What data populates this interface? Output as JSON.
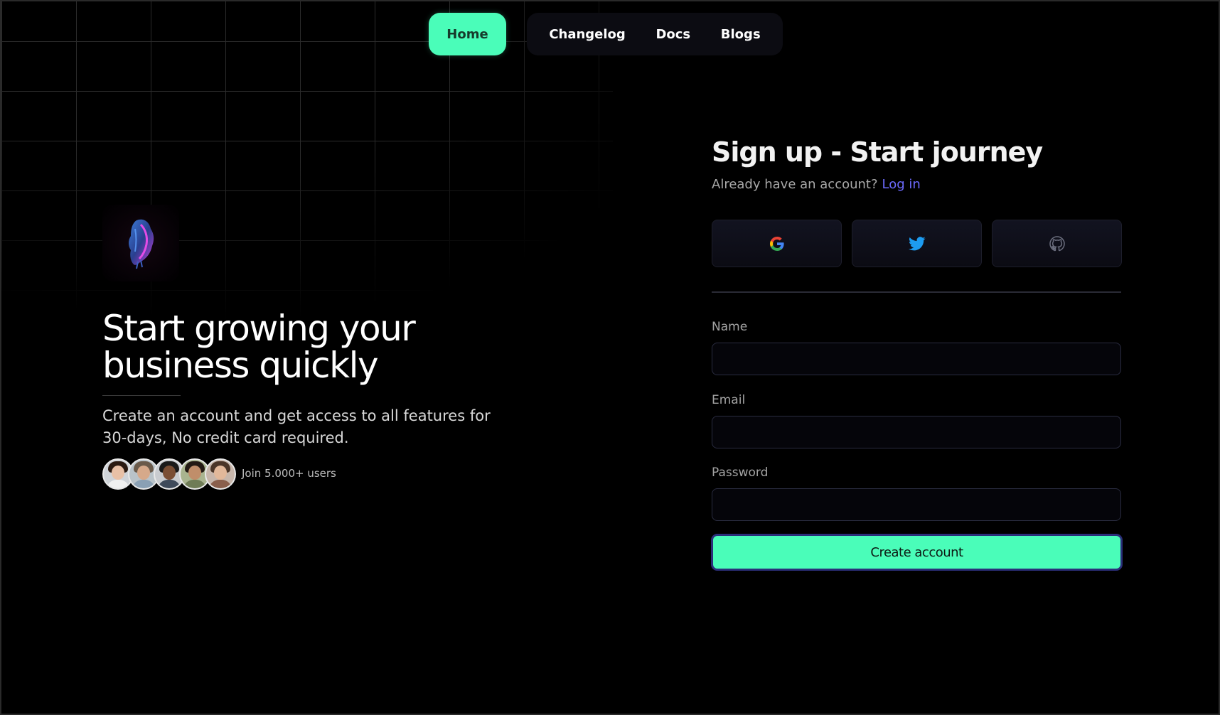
{
  "nav": {
    "home": "Home",
    "links": [
      "Changelog",
      "Docs",
      "Blogs"
    ]
  },
  "hero": {
    "title_line1": "Start growing your",
    "title_line2": "business quickly",
    "subtitle": "Create an account and get access to all features for 30-days, No credit card required.",
    "users_text": "Join 5.000+ users",
    "avatar_count": 5
  },
  "form": {
    "title": "Sign up - Start journey",
    "have_account": "Already have an account?",
    "login_link": "Log in",
    "social": [
      "google-icon",
      "twitter-icon",
      "github-icon"
    ],
    "name_label": "Name",
    "name_value": "",
    "email_label": "Email",
    "email_value": "",
    "password_label": "Password",
    "password_value": "",
    "submit_label": "Create account"
  },
  "colors": {
    "accent": "#4afdb9",
    "link": "#6d6bff",
    "background": "#000000",
    "twitter": "#1d9bf0"
  }
}
